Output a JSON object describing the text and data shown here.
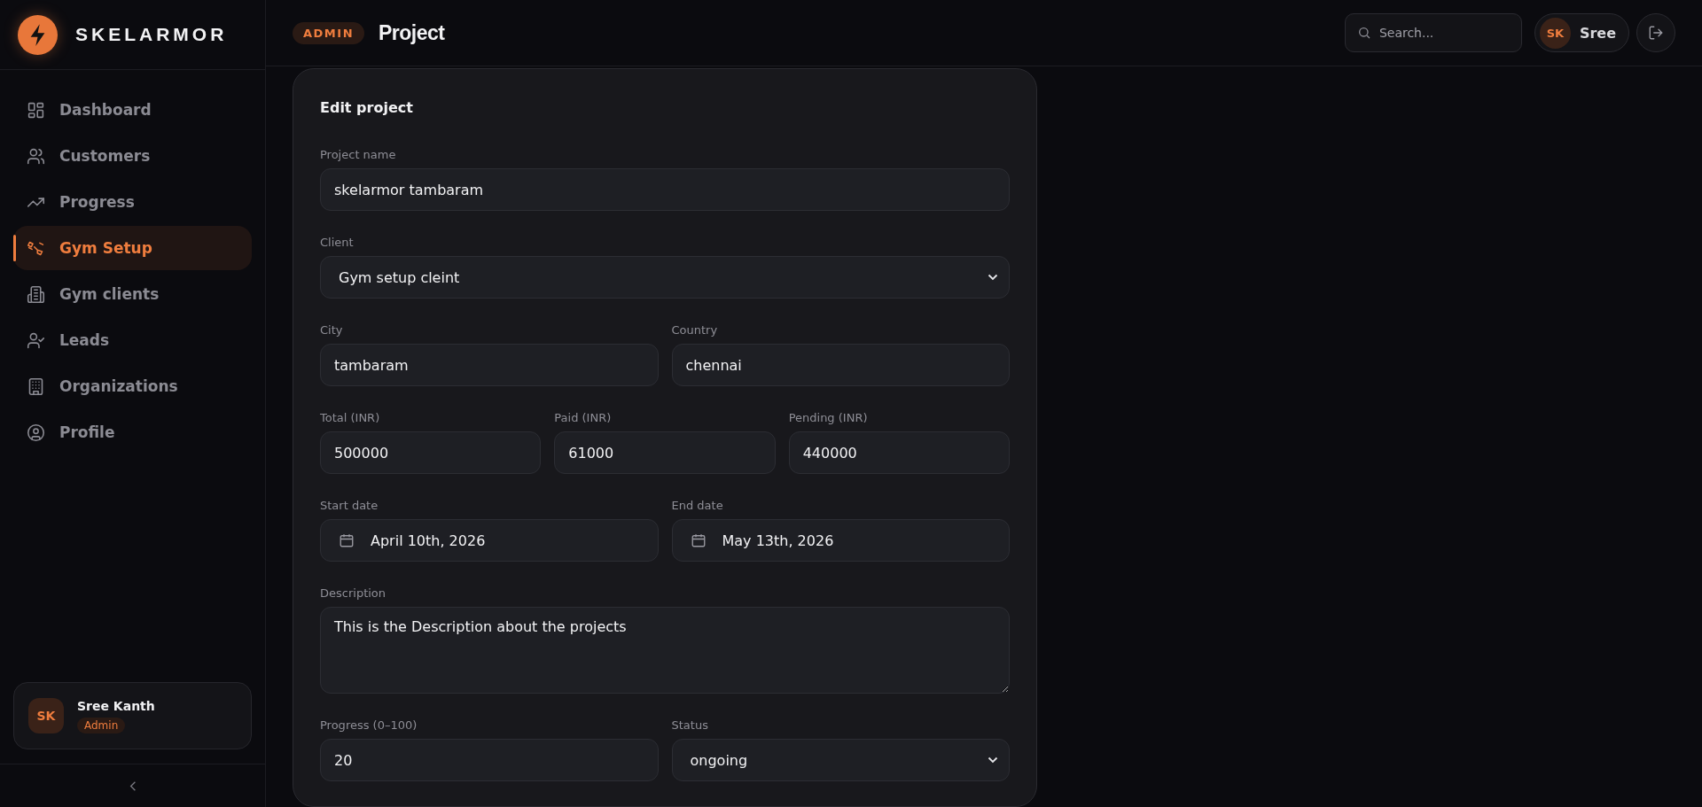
{
  "brand": {
    "name": "SKELARMOR"
  },
  "sidebar": {
    "items": [
      {
        "label": "Dashboard",
        "selected": false
      },
      {
        "label": "Customers",
        "selected": false
      },
      {
        "label": "Progress",
        "selected": false
      },
      {
        "label": "Gym Setup",
        "selected": true
      },
      {
        "label": "Gym clients",
        "selected": false
      },
      {
        "label": "Leads",
        "selected": false
      },
      {
        "label": "Organizations",
        "selected": false
      },
      {
        "label": "Profile",
        "selected": false
      }
    ],
    "user": {
      "initials": "SK",
      "name": "Sree Kanth",
      "role": "Admin"
    }
  },
  "header": {
    "badge": "ADMIN",
    "title": "Project",
    "search": {
      "placeholder": "Search..."
    },
    "user": {
      "initials": "SK",
      "name": "Sree"
    }
  },
  "form": {
    "title": "Edit project",
    "rows": [
      {
        "fields": [
          {
            "kind": "text",
            "label": "Project name",
            "value": "skelarmor tambaram"
          }
        ]
      },
      {
        "fields": [
          {
            "kind": "select",
            "label": "Client",
            "value": "Gym setup cleint"
          }
        ]
      },
      {
        "fields": [
          {
            "kind": "text",
            "label": "City",
            "value": "tambaram"
          },
          {
            "kind": "text",
            "label": "Country",
            "value": "chennai"
          }
        ]
      },
      {
        "fields": [
          {
            "kind": "text",
            "label": "Total (INR)",
            "value": "500000"
          },
          {
            "kind": "text",
            "label": "Paid (INR)",
            "value": "61000"
          },
          {
            "kind": "text",
            "label": "Pending (INR)",
            "value": "440000"
          }
        ]
      },
      {
        "fields": [
          {
            "kind": "date",
            "label": "Start date",
            "value": "April 10th, 2026"
          },
          {
            "kind": "date",
            "label": "End date",
            "value": "May 13th, 2026"
          }
        ]
      },
      {
        "fields": [
          {
            "kind": "textarea",
            "label": "Description",
            "value": "This is the Description about the projects"
          }
        ]
      },
      {
        "fields": [
          {
            "kind": "text",
            "label": "Progress (0–100)",
            "value": "20"
          },
          {
            "kind": "select",
            "label": "Status",
            "value": "ongoing"
          }
        ]
      }
    ]
  }
}
